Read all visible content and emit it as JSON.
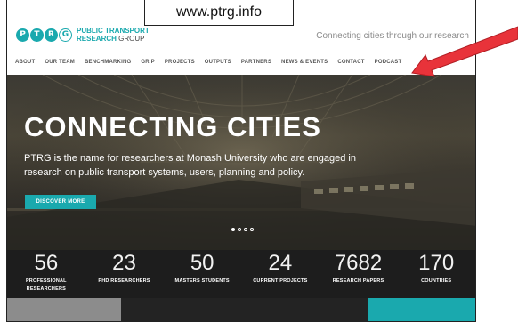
{
  "url_label": "www.ptrg.info",
  "logo": {
    "letters": [
      "P",
      "T",
      "R",
      "G"
    ],
    "line1": "PUBLIC TRANSPORT",
    "line2_bold": "RESEARCH",
    "line2_rest": "GROUP"
  },
  "tagline": "Connecting cities through our research",
  "nav": [
    "ABOUT",
    "OUR TEAM",
    "BENCHMARKING",
    "GRIP",
    "PROJECTS",
    "OUTPUTS",
    "PARTNERS",
    "NEWS & EVENTS",
    "CONTACT",
    "PODCAST"
  ],
  "hero": {
    "title": "CONNECTING CITIES",
    "description": "PTRG is the name for researchers at Monash University who are engaged in research on public transport systems, users, planning and policy.",
    "button": "DISCOVER MORE",
    "slides_total": 4,
    "slide_active": 1
  },
  "stats": [
    {
      "value": "56",
      "label": "PROFESSIONAL RESEARCHERS"
    },
    {
      "value": "23",
      "label": "PHD RESEARCHERS"
    },
    {
      "value": "50",
      "label": "MASTERS STUDENTS"
    },
    {
      "value": "24",
      "label": "CURRENT PROJECTS"
    },
    {
      "value": "7682",
      "label": "RESEARCH PAPERS"
    },
    {
      "value": "170",
      "label": "COUNTRIES"
    }
  ],
  "colors": {
    "accent": "#1aa9ae",
    "arrow": "#e8333a",
    "stats_bg": "#1d1d1d"
  }
}
